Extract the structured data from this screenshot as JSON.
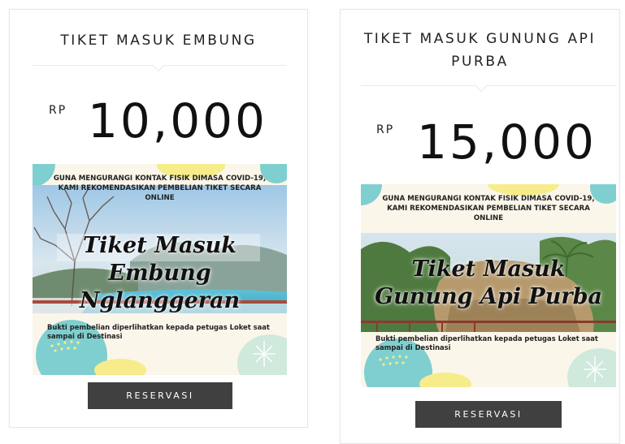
{
  "cards": [
    {
      "title": "TIKET MASUK EMBUNG",
      "currency": "RP",
      "price": "10,000",
      "poster": {
        "header": "GUNA MENGURANGI KONTAK FISIK DIMASA COVID-19, KAMI REKOMENDASIKAN PEMBELIAN TIKET SECARA ONLINE",
        "title_line1": "Tiket Masuk",
        "title_line2": "Embung Nglanggeran",
        "footer": "Bukti pembelian diperlihatkan kepada petugas Loket saat sampai di Destinasi"
      },
      "button_label": "RESERVASI"
    },
    {
      "title": "TIKET MASUK GUNUNG API PURBA",
      "currency": "RP",
      "price": "15,000",
      "poster": {
        "header": "GUNA MENGURANGI KONTAK FISIK DIMASA COVID-19, KAMI REKOMENDASIKAN PEMBELIAN TIKET SECARA ONLINE",
        "title_line1": "Tiket Masuk",
        "title_line2": "Gunung Api Purba",
        "footer": "Bukti pembelian diperlihatkan kepada petugas Loket saat sampai di Destinasi"
      },
      "button_label": "RESERVASI"
    }
  ],
  "colors": {
    "button_bg": "#404040",
    "poster_teal": "#7fcfd0",
    "poster_yellow": "#f6ec8a",
    "poster_mint": "#cfe9dc"
  }
}
